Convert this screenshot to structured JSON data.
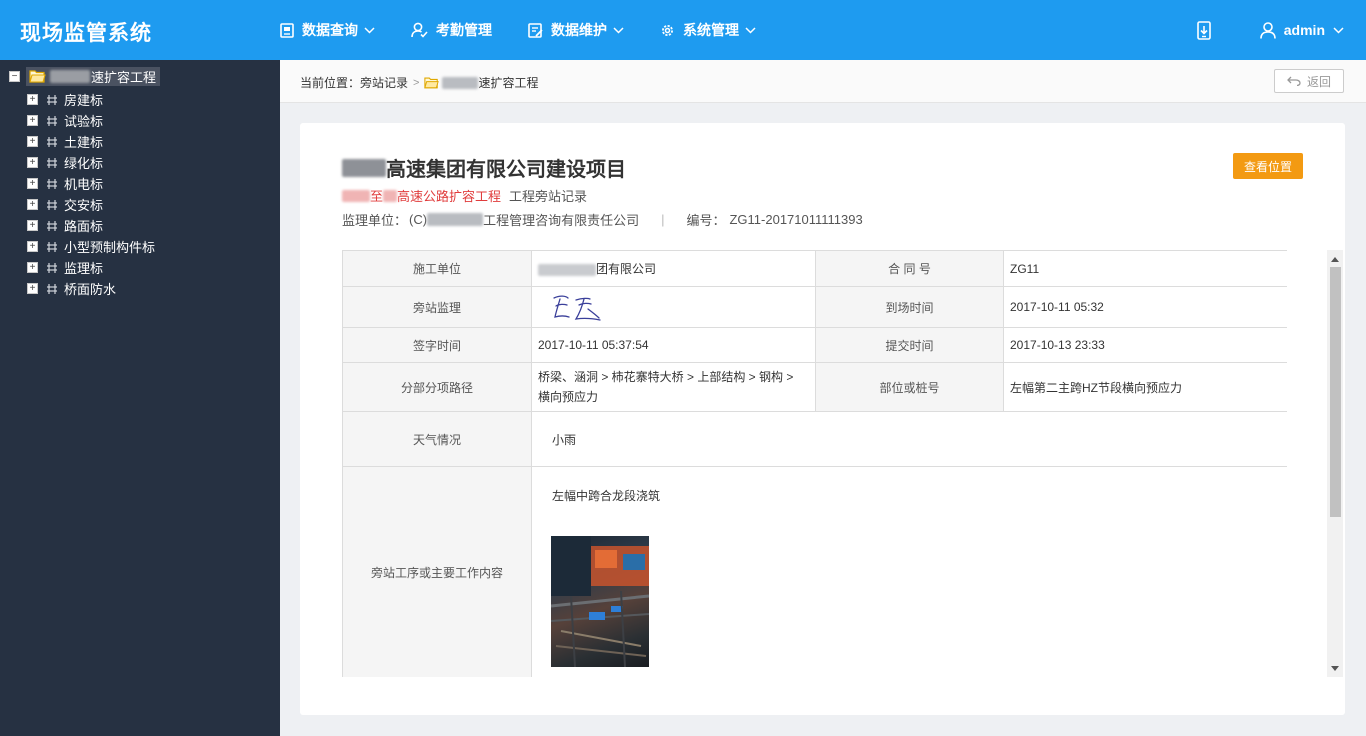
{
  "app": {
    "title": "现场监管系统"
  },
  "nav": {
    "items": [
      {
        "label": "数据查询",
        "icon": "document-icon",
        "has_dropdown": true
      },
      {
        "label": "考勤管理",
        "icon": "user-check-icon",
        "has_dropdown": false
      },
      {
        "label": "数据维护",
        "icon": "edit-doc-icon",
        "has_dropdown": true
      },
      {
        "label": "系统管理",
        "icon": "gear-icon",
        "has_dropdown": true
      }
    ]
  },
  "user": {
    "name": "admin"
  },
  "sidebar": {
    "root": {
      "label": "速扩容工程",
      "toggle": "−"
    },
    "items": [
      {
        "label": "房建标",
        "toggle": "+"
      },
      {
        "label": "试验标",
        "toggle": "+"
      },
      {
        "label": "土建标",
        "toggle": "+"
      },
      {
        "label": "绿化标",
        "toggle": "+"
      },
      {
        "label": "机电标",
        "toggle": "+"
      },
      {
        "label": "交安标",
        "toggle": "+"
      },
      {
        "label": "路面标",
        "toggle": "+"
      },
      {
        "label": "小型预制构件标",
        "toggle": "+"
      },
      {
        "label": "监理标",
        "toggle": "+"
      },
      {
        "label": "桥面防水",
        "toggle": "+"
      }
    ]
  },
  "breadcrumb": {
    "prefix": "当前位置：",
    "first": "旁站记录",
    "separator": ">",
    "second": "速扩容工程"
  },
  "back_button": {
    "label": "返回"
  },
  "record": {
    "title": "高速集团有限公司建设项目",
    "view_location_label": "查看位置",
    "subtitle_red_a": "至",
    "subtitle_red_b": "高速公路扩容工程",
    "subtitle_rest": "工程旁站记录",
    "supervisor_prefix": "监理单位：",
    "supervisor_code": "(C)",
    "supervisor_name": "工程管理咨询有限责任公司",
    "meta_divider": "|",
    "number_label": "编号：",
    "number_value": "ZG11-20171011111393"
  },
  "table": {
    "construction_unit_label": "施工单位",
    "construction_unit_value": "团有限公司",
    "contract_label": "合 同 号",
    "contract_value": "ZG11",
    "supervisor_label": "旁站监理",
    "arrival_label": "到场时间",
    "arrival_value": "2017-10-11 05:32",
    "sign_time_label": "签字时间",
    "sign_time_value": "2017-10-11 05:37:54",
    "submit_label": "提交时间",
    "submit_value": "2017-10-13 23:33",
    "path_label": "分部分项路径",
    "path_value_line1": "桥梁、涵洞 > 柿花寨特大桥 > 上部结构 > 钢构 >",
    "path_value_line2": "横向预应力",
    "location_label": "部位或桩号",
    "location_value": "左幅第二主跨HZ节段横向预应力",
    "weather_label": "天气情况",
    "weather_value": "小雨",
    "work_label": "旁站工序或主要工作内容",
    "work_value": "左幅中跨合龙段浇筑"
  },
  "colors": {
    "topbar": "#1e9bf0",
    "sidebar": "#263142",
    "accent_orange": "#f39a12",
    "highlight_red": "#e03c3c"
  }
}
